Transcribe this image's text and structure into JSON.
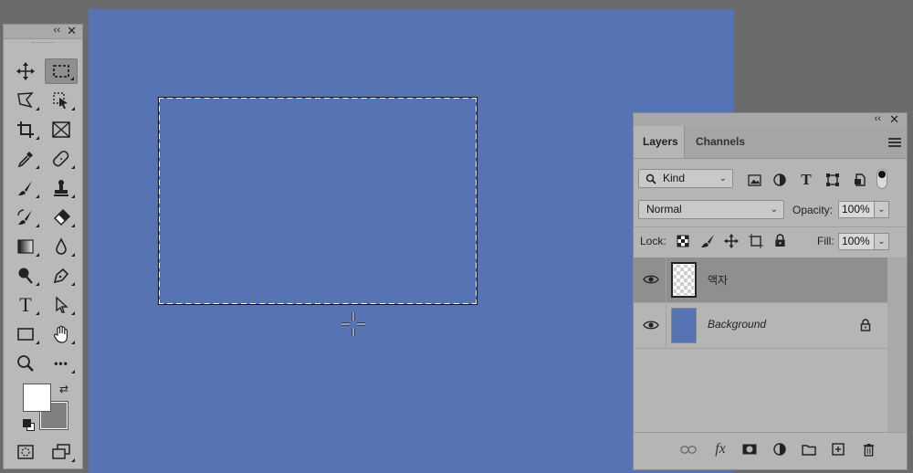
{
  "toolbox": {
    "collapse_glyph": "‹‹",
    "close_glyph": "✕",
    "tools": [
      {
        "name": "move-tool",
        "icon": "move-icon"
      },
      {
        "name": "rectangular-marquee-tool",
        "icon": "marquee-icon",
        "active": true
      },
      {
        "name": "lasso-tool",
        "icon": "lasso-icon"
      },
      {
        "name": "object-selection-tool",
        "icon": "object-select-icon"
      },
      {
        "name": "crop-tool",
        "icon": "crop-icon"
      },
      {
        "name": "frame-tool",
        "icon": "frame-icon"
      },
      {
        "name": "eyedropper-tool",
        "icon": "eyedropper-icon"
      },
      {
        "name": "healing-brush-tool",
        "icon": "bandage-icon"
      },
      {
        "name": "brush-tool",
        "icon": "brush-icon"
      },
      {
        "name": "clone-stamp-tool",
        "icon": "stamp-icon"
      },
      {
        "name": "history-brush-tool",
        "icon": "history-brush-icon"
      },
      {
        "name": "eraser-tool",
        "icon": "eraser-icon"
      },
      {
        "name": "gradient-tool",
        "icon": "gradient-icon"
      },
      {
        "name": "blur-tool",
        "icon": "drop-icon"
      },
      {
        "name": "dodge-tool",
        "icon": "dodge-icon"
      },
      {
        "name": "pen-tool",
        "icon": "pen-icon"
      },
      {
        "name": "type-tool",
        "icon": "type-icon",
        "glyph": "T"
      },
      {
        "name": "path-selection-tool",
        "icon": "arrow-icon"
      },
      {
        "name": "rectangle-tool",
        "icon": "rectangle-icon"
      },
      {
        "name": "hand-tool",
        "icon": "hand-icon"
      },
      {
        "name": "zoom-tool",
        "icon": "zoom-icon"
      },
      {
        "name": "more-tools",
        "icon": "ellipsis-icon",
        "glyph": "•••"
      }
    ],
    "foreground_color": "#ffffff",
    "background_color": "#808080"
  },
  "canvas": {
    "color": "#5674b4"
  },
  "layers_panel": {
    "collapse_glyph": "‹‹",
    "close_glyph": "✕",
    "tabs": [
      {
        "label": "Layers",
        "active": true
      },
      {
        "label": "Channels",
        "active": false
      }
    ],
    "filter": {
      "label": "Kind"
    },
    "blend_mode": "Normal",
    "opacity_label": "Opacity:",
    "opacity_value": "100%",
    "lock_label": "Lock:",
    "fill_label": "Fill:",
    "fill_value": "100%",
    "layers": [
      {
        "name": "액자",
        "visible": true,
        "selected": true,
        "thumb": "transparent",
        "locked": false
      },
      {
        "name": "Background",
        "visible": true,
        "selected": false,
        "thumb": "#5674b4",
        "locked": true
      }
    ],
    "footer": {
      "fx_label": "fx"
    }
  }
}
